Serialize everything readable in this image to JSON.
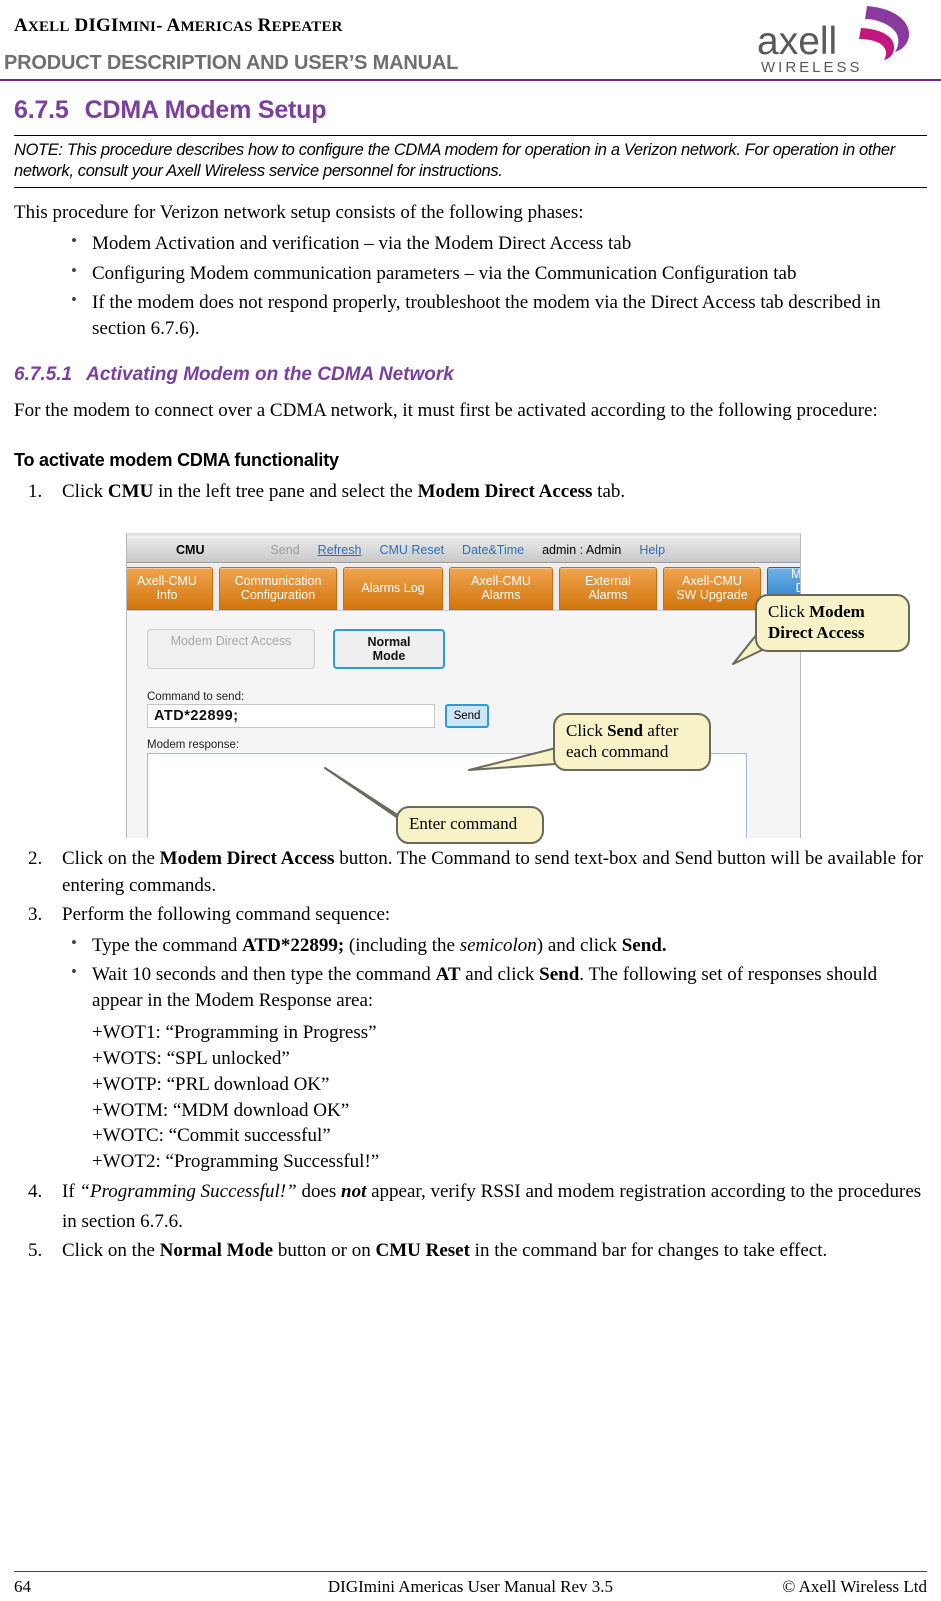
{
  "header": {
    "title_line1_a": "A",
    "title_line1": "XELL DIGI",
    "product_title": "PRODUCT DESCRIPTION AND USER’S MANUAL",
    "doc_title_full": "AXELL DIGImini- AMERICAS REPEATER",
    "logo_wordmark": "axell",
    "logo_subtext": "WIRELESS",
    "brand_purple": "#6a2a8c",
    "brand_magenta": "#c2187e"
  },
  "section": {
    "number": "6.7.5",
    "title": "CDMA Modem Setup",
    "note": "NOTE: This procedure describes how to configure the CDMA modem for operation in a Verizon network. For operation in other network, consult your Axell Wireless service personnel for instructions.",
    "intro": "This procedure for Verizon network setup consists of the following phases:",
    "phases": [
      "Modem Activation and verification – via the Modem Direct Access tab",
      "Configuring Modem communication parameters – via the Communication Configuration tab",
      "If the modem does not respond properly, troubleshoot the modem via the Direct Access tab described in section 6.7.6)."
    ]
  },
  "subsection": {
    "number": "6.7.5.1",
    "title": "Activating Modem on the CDMA Network",
    "intro": "For the modem to connect over a CDMA network, it must first be activated according to the following procedure:",
    "runin_heading": "To activate modem CDMA functionality"
  },
  "steps": {
    "s1_num": "1.",
    "s1_a": "Click ",
    "s1_b1": "CMU",
    "s1_c": " in the left tree pane and select the ",
    "s1_b2": "Modem Direct Access",
    "s1_d": " tab.",
    "s2_num": "2.",
    "s2_a": "Click on the ",
    "s2_b": "Modem Direct Access",
    "s2_c": " button. The Command to send text-box and Send button will be available for entering commands.",
    "s3_num": "3.",
    "s3_a": "Perform the following command sequence:",
    "s3_bullet1_a": "Type the command ",
    "s3_bullet1_b": "ATD*22899;",
    "s3_bullet1_c": " (including the ",
    "s3_bullet1_i": "semicolon",
    "s3_bullet1_d": ") and click ",
    "s3_bullet1_e": "Send.",
    "s3_bullet2_a": "Wait 10 seconds and then type the command ",
    "s3_bullet2_b": "AT",
    "s3_bullet2_c": " and click ",
    "s3_bullet2_d": "Send",
    "s3_bullet2_e": ". The following set of responses should appear in the Modem Response area:",
    "responses": [
      "+WOT1: “Programming in Progress”",
      "+WOTS: “SPL unlocked”",
      "+WOTP: “PRL download OK”",
      "+WOTM: “MDM download OK”",
      "+WOTC: “Commit successful”",
      "+WOT2: “Programming Successful!”"
    ],
    "s4_num": "4.",
    "s4_a": "If ",
    "s4_i": "“Programming Successful!”",
    "s4_b": " does ",
    "s4_bi": "not",
    "s4_c": " appear, verify RSSI and modem registration according to the procedures in section 6.7.6.",
    "s5_num": "5.",
    "s5_a": "Click on the ",
    "s5_b1": "Normal Mode",
    "s5_c": " button or on ",
    "s5_b2": "CMU Reset",
    "s5_d": " in the command bar for changes to take effect."
  },
  "screenshot": {
    "menubar": {
      "app_title": "CMU",
      "send": "Send",
      "refresh": "Refresh",
      "cmu_reset": "CMU Reset",
      "date_time": "Date&Time",
      "user": "admin : Admin",
      "help": "Help"
    },
    "tabs": [
      {
        "label": "Axell-CMU Info",
        "selected": false
      },
      {
        "label": "Communication Configuration",
        "selected": false
      },
      {
        "label": "Alarms Log",
        "selected": false
      },
      {
        "label": "Axell-CMU Alarms",
        "selected": false
      },
      {
        "label": "External Alarms",
        "selected": false
      },
      {
        "label": "Axell-CMU SW Upgrade",
        "selected": false
      },
      {
        "label": "Modem Direct Access",
        "selected": true
      }
    ],
    "tab_labels": {
      "t1": "Axell-CMU Info",
      "t2a": "Communication",
      "t2b": "Configuration",
      "t3": "Alarms Log",
      "t4": "Axell-CMU Alarms",
      "t5": "External Alarms",
      "t6a": "Axell-CMU",
      "t6b": "SW Upgrade",
      "t7a": "Modem Direct",
      "t7b": "Access"
    },
    "panel": {
      "modem_direct_access_button": "Modem Direct Access",
      "normal_mode_button": "Normal Mode",
      "command_label": "Command to send:",
      "command_value": "ATD*22899;",
      "send_button": "Send",
      "response_label": "Modem response:",
      "response_value": ""
    },
    "callouts": {
      "c1_a": "Click ",
      "c1_b": "Modem Direct Access",
      "c2_a": "Click ",
      "c2_b": "Send",
      "c2_c": " after each command",
      "c3": "Enter command"
    }
  },
  "footer": {
    "page_number": "64",
    "center": "DIGImini Americas User Manual Rev 3.5",
    "right": "© Axell Wireless Ltd"
  }
}
